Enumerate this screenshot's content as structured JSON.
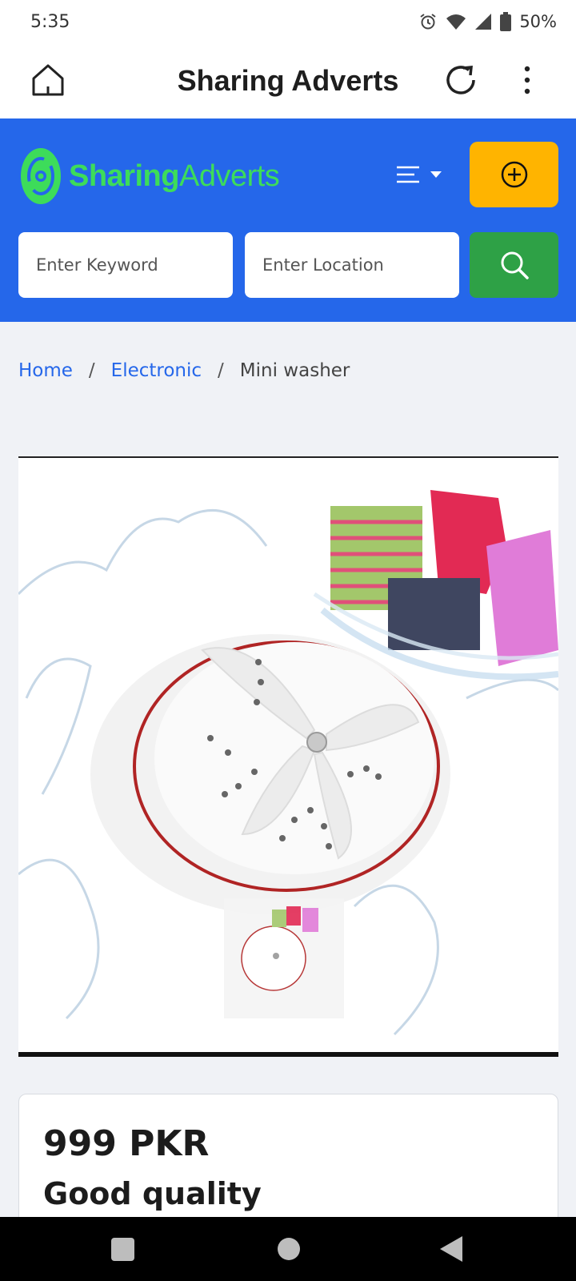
{
  "status_bar": {
    "time": "5:35",
    "battery": "50%",
    "icons": [
      "alarm-icon",
      "wifi-icon",
      "signal-icon",
      "battery-icon"
    ]
  },
  "app_bar": {
    "title": "Sharing Adverts",
    "icons": [
      "home-icon",
      "refresh-icon",
      "more-vert-icon"
    ]
  },
  "header": {
    "logo_text_1": "Sharing",
    "logo_text_2": "Adverts",
    "brand_colors": {
      "header_bg": "#2567ea",
      "logo": "#3ddc5a",
      "post_ad": "#ffb400",
      "search": "#2ea146"
    },
    "keyword_placeholder": "Enter Keyword",
    "location_placeholder": "Enter Location",
    "icons": [
      "menu-lines-icon",
      "caret-down-icon",
      "plus-circle-icon",
      "search-icon"
    ]
  },
  "breadcrumb": {
    "items": [
      "Home",
      "Electronic",
      "Mini washer"
    ],
    "separator": "/"
  },
  "listing": {
    "price": "999 PKR",
    "title": "Good quality"
  },
  "nav_bar": {
    "icons": [
      "recents-icon",
      "home-circle-icon",
      "back-icon"
    ]
  }
}
